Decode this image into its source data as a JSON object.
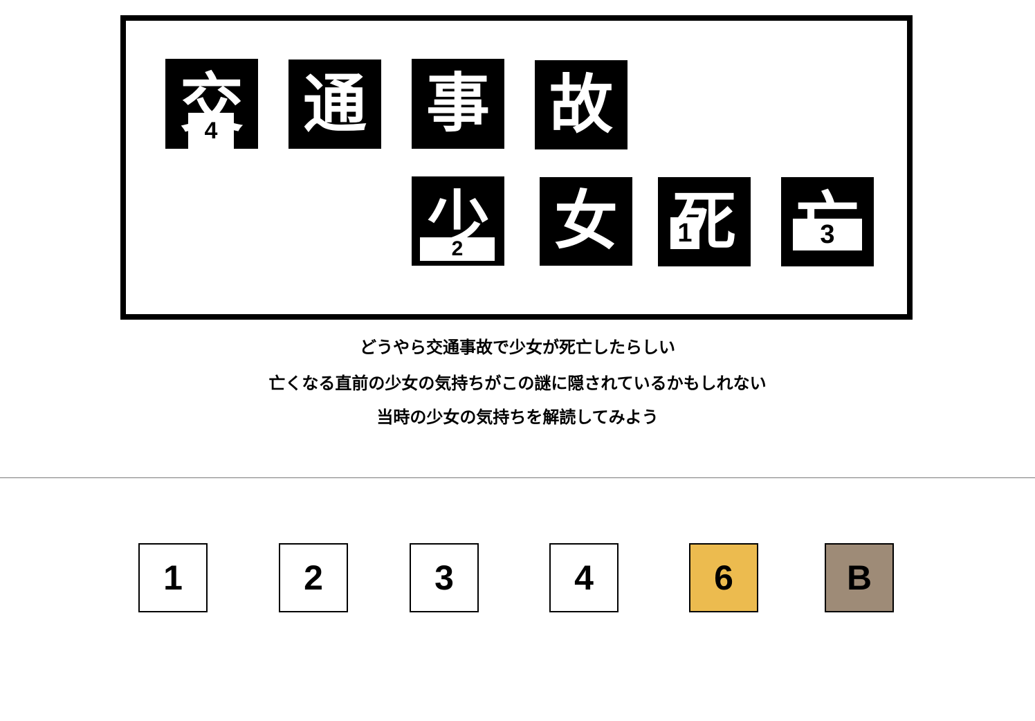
{
  "board": {
    "row1": [
      {
        "kanji": "交",
        "number": "4"
      },
      {
        "kanji": "通",
        "number": ""
      },
      {
        "kanji": "事",
        "number": ""
      },
      {
        "kanji": "故",
        "number": ""
      }
    ],
    "row2": [
      {
        "kanji": "少",
        "number": "2"
      },
      {
        "kanji": "女",
        "number": ""
      },
      {
        "kanji": "死",
        "number": "1"
      },
      {
        "kanji": "亡",
        "number": "3"
      }
    ]
  },
  "message": [
    "どうやら交通事故で少女が死亡したらしい",
    "亡くなる直前の少女の気持ちがこの謎に隠されているかもしれない",
    "当時の少女の気持ちを解読してみよう"
  ],
  "keys": [
    {
      "label": "1",
      "color": "#ffffff"
    },
    {
      "label": "2",
      "color": "#ffffff"
    },
    {
      "label": "3",
      "color": "#ffffff"
    },
    {
      "label": "4",
      "color": "#ffffff"
    },
    {
      "label": "6",
      "color": "#ecbb4f"
    },
    {
      "label": "B",
      "color": "#9e8b77"
    }
  ]
}
